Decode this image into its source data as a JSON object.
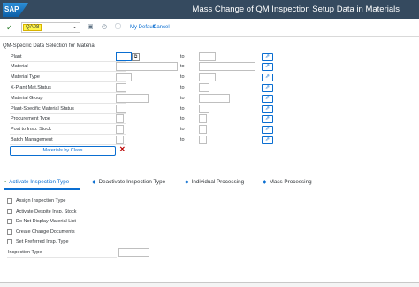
{
  "header": {
    "logo": "SAP",
    "title": "Mass Change of QM Inspection Setup Data in Materials"
  },
  "toolbar": {
    "command_value": "QA08",
    "my_default": "My Default",
    "cancel": "Cancel",
    "icons": [
      "checkmark-icon",
      "save-icon",
      "settings-icon",
      "info-icon"
    ]
  },
  "selection": {
    "title": "QM-Specific Data Selection for Material",
    "to_label": "to",
    "rows": [
      {
        "label": "Plant"
      },
      {
        "label": "Material"
      },
      {
        "label": "Material Type"
      },
      {
        "label": "X-Plant Mat.Status"
      },
      {
        "label": "Material Group"
      },
      {
        "label": "Plant-Specific Material Status"
      },
      {
        "label": "Procurement Type"
      },
      {
        "label": "Post to Insp. Stock"
      },
      {
        "label": "Batch Management"
      }
    ],
    "materials_by_class": "Materials by Class"
  },
  "tabs": [
    {
      "label": "Activate Inspection Type",
      "active": true
    },
    {
      "label": "Deactivate Inspection Type",
      "active": false
    },
    {
      "label": "Individual Processing",
      "active": false
    },
    {
      "label": "Mass Processing",
      "active": false
    }
  ],
  "options": [
    {
      "label": "Assign Inspection Type",
      "checked": false
    },
    {
      "label": "Activate Despite Insp. Stock",
      "checked": false
    },
    {
      "label": "Do Not Display Material List",
      "checked": false
    },
    {
      "label": "Create Change Documents",
      "checked": false
    },
    {
      "label": "Set Preferred Insp. Type",
      "checked": false
    }
  ],
  "inspection_type": {
    "label": "Inspection Type",
    "value": ""
  },
  "colors": {
    "shell": "#354a5f",
    "accent": "#0a6ed1",
    "command_highlight": "#fff54a"
  }
}
